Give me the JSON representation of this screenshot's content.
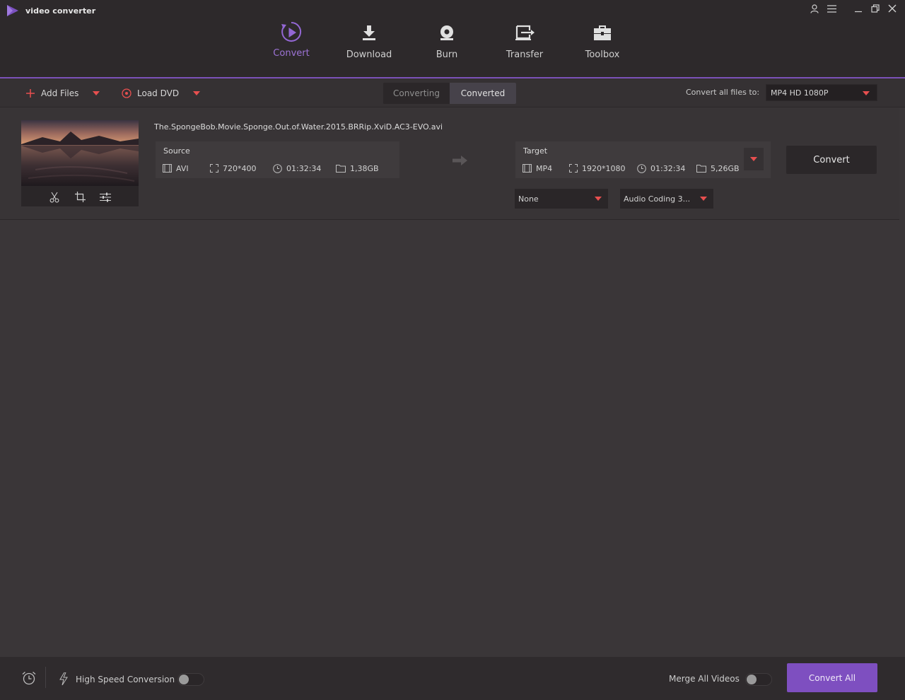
{
  "app": {
    "title": "video converter"
  },
  "nav": {
    "items": [
      {
        "label": "Convert",
        "icon": "convert-icon",
        "active": true
      },
      {
        "label": "Download",
        "icon": "download-icon",
        "active": false
      },
      {
        "label": "Burn",
        "icon": "burn-icon",
        "active": false
      },
      {
        "label": "Transfer",
        "icon": "transfer-icon",
        "active": false
      },
      {
        "label": "Toolbox",
        "icon": "toolbox-icon",
        "active": false
      }
    ]
  },
  "toolbar": {
    "add_files": "Add Files",
    "load_dvd": "Load DVD",
    "tabs": [
      {
        "label": "Converting",
        "active": false
      },
      {
        "label": "Converted",
        "active": true
      }
    ],
    "convert_all_to_label": "Convert all files to:",
    "format_value": "MP4 HD 1080P"
  },
  "file": {
    "name": "The.SpongeBob.Movie.Sponge.Out.of.Water.2015.BRRip.XviD.AC3-EVO.avi",
    "source": {
      "title": "Source",
      "format": "AVI",
      "resolution": "720*400",
      "duration": "01:32:34",
      "size": "1,38GB"
    },
    "target": {
      "title": "Target",
      "format": "MP4",
      "resolution": "1920*1080",
      "duration": "01:32:34",
      "size": "5,26GB"
    },
    "convert_label": "Convert",
    "subtitle_value": "None",
    "audio_value": "Audio Coding 3..."
  },
  "footer": {
    "high_speed_label": "High Speed Conversion",
    "high_speed_on": false,
    "merge_label": "Merge All Videos",
    "merge_on": false,
    "convert_all_label": "Convert All"
  },
  "colors": {
    "accent": "#8e61cf",
    "caret": "#e84f4f",
    "convert_all_bg": "#7e4fc0"
  }
}
